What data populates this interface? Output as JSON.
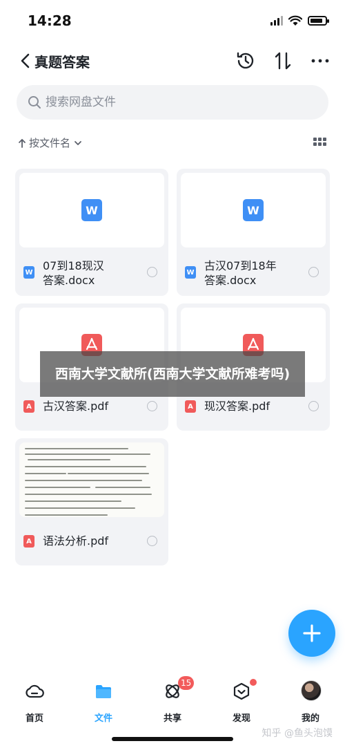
{
  "status_bar": {
    "time": "14:28"
  },
  "header": {
    "title": "真题答案"
  },
  "search": {
    "placeholder": "搜索网盘文件"
  },
  "sort": {
    "label": "按文件名"
  },
  "files": [
    {
      "name_line1": "07到18现汉",
      "name_line2": "答案.docx",
      "type": "word",
      "type_glyph": "W"
    },
    {
      "name_line1": "古汉07到18年",
      "name_line2": "答案.docx",
      "type": "word",
      "type_glyph": "W"
    },
    {
      "name_line1": "古汉答案.pdf",
      "name_line2": "",
      "type": "pdf",
      "type_glyph": "A"
    },
    {
      "name_line1": "现汉答案.pdf",
      "name_line2": "",
      "type": "pdf",
      "type_glyph": "A"
    },
    {
      "name_line1": "语法分析.pdf",
      "name_line2": "",
      "type": "pdf",
      "type_glyph": "A"
    }
  ],
  "overlay": {
    "text": "西南大学文献所(西南大学文献所难考吗)"
  },
  "tabbar": {
    "tabs": [
      {
        "label": "首页",
        "icon": "cloud-icon"
      },
      {
        "label": "文件",
        "icon": "folder-icon"
      },
      {
        "label": "共享",
        "icon": "share-icon",
        "badge": "15"
      },
      {
        "label": "发现",
        "icon": "discover-icon"
      },
      {
        "label": "我的",
        "icon": "avatar"
      }
    ],
    "active": "文件"
  },
  "watermark": "知乎 @鱼头泡馍",
  "colors": {
    "accent": "#2aa4ff",
    "word": "#3f8ff5",
    "pdf": "#f05a5a",
    "badge": "#f25b5b"
  }
}
